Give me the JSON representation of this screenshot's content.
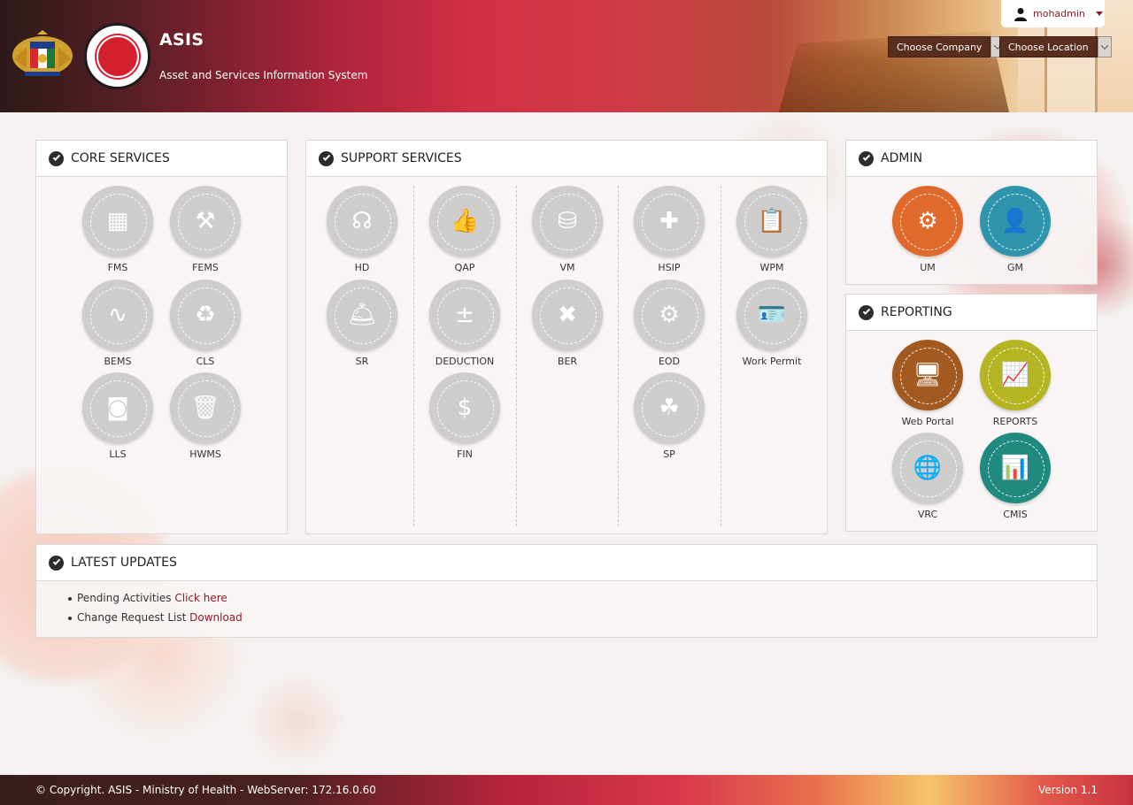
{
  "header": {
    "title": "ASIS",
    "subtitle": "Asset and Services Information System",
    "user": "mohadmin",
    "company_select": "Choose Company",
    "location_select": "Choose Location"
  },
  "core_services": {
    "title": "CORE SERVICES",
    "items": [
      "FMS",
      "FEMS",
      "BEMS",
      "CLS",
      "LLS",
      "HWMS"
    ]
  },
  "support_services": {
    "title": "SUPPORT SERVICES",
    "items": [
      "HD",
      "QAP",
      "VM",
      "HSIP",
      "WPM",
      "SR",
      "DEDUCTION",
      "BER",
      "EOD",
      "Work Permit",
      "FIN",
      "SP"
    ]
  },
  "admin": {
    "title": "ADMIN",
    "items": [
      "UM",
      "GM"
    ]
  },
  "reporting": {
    "title": "REPORTING",
    "items": [
      "Web Portal",
      "REPORTS",
      "VRC",
      "CMIS"
    ]
  },
  "updates": {
    "title": "LATEST UPDATES",
    "items": [
      {
        "text": "Pending Activities",
        "link": "Click here"
      },
      {
        "text": "Change Request List",
        "link": "Download"
      }
    ]
  },
  "footer": {
    "copyright": "© Copyright. ASIS - Ministry of Health - WebServer: 172.16.0.60",
    "version": "Version 1.1"
  },
  "colors": {
    "brand_dark": "#8b1c28",
    "tile_gray": "#cfcdcc",
    "um": "#e06a2c",
    "gm": "#2f95ad",
    "web_portal": "#a35a20",
    "reports": "#b5b524",
    "cmis": "#208a80"
  }
}
